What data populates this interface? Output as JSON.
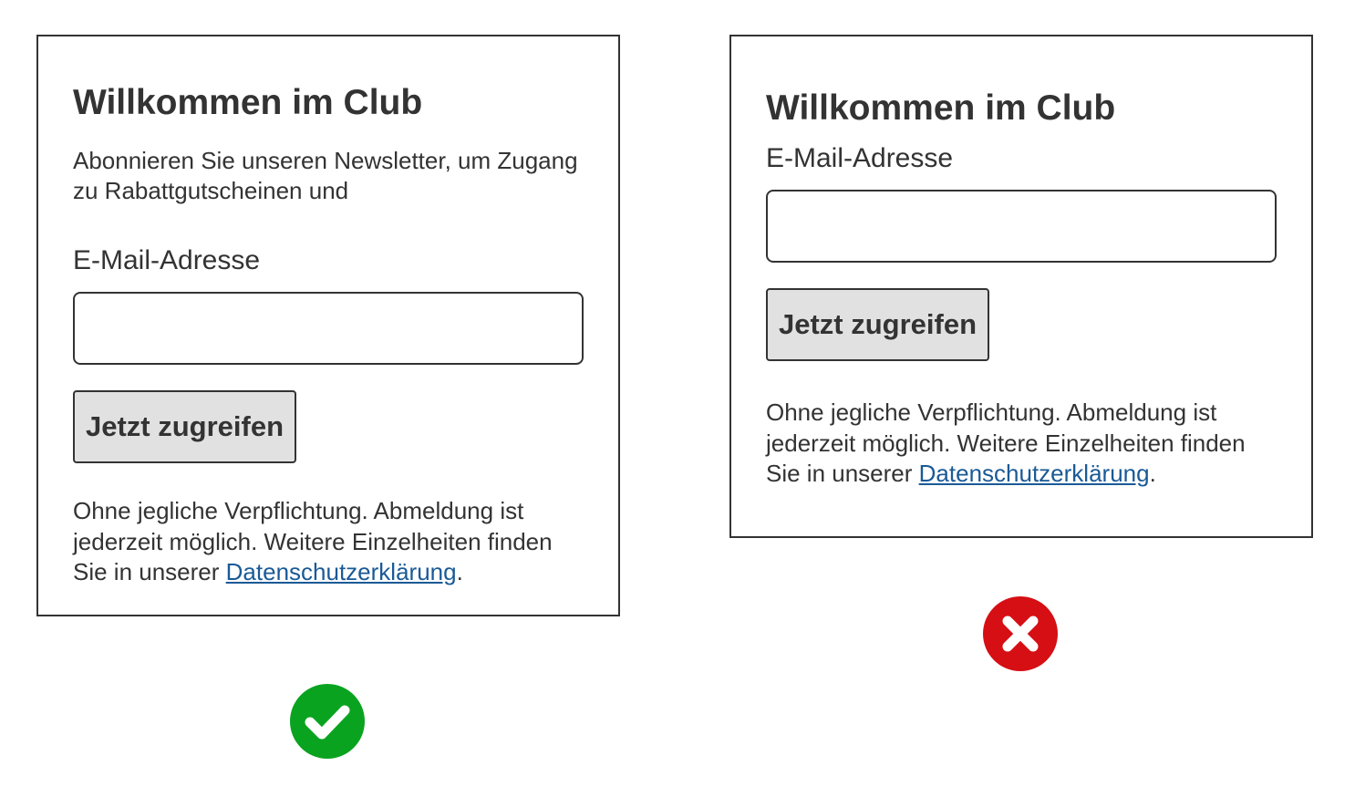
{
  "good_example": {
    "title": "Willkommen im Club",
    "intro": "Abonnieren Sie unseren Newsletter, um Zugang zu Rabattgutscheinen und",
    "email_label": "E-Mail-Adresse",
    "email_value": "",
    "button_label": "Jetzt zugreifen",
    "note_text": "Ohne jegliche Verpflichtung. Abmeldung ist jederzeit möglich. Weitere Einzelheiten finden Sie in unserer ",
    "privacy_link": "Datenschutzerklärung",
    "note_end": ".",
    "verdict_icon": "checkmark-icon",
    "verdict_color": "#0aa31f"
  },
  "bad_example": {
    "title": "Willkommen im Club",
    "email_label": "E-Mail-Adresse",
    "email_value": "",
    "button_label": "Jetzt zugreifen",
    "note_text": "Ohne jegliche Verpflichtung. Abmeldung ist jederzeit möglich. Weitere Einzelheiten finden Sie in unserer ",
    "privacy_link": "Datenschutzerklärung",
    "note_end": ".",
    "verdict_icon": "cross-icon",
    "verdict_color": "#d50f14"
  },
  "colors": {
    "text": "#333333",
    "border": "#333333",
    "button_bg": "#e1e1e1",
    "link": "#1a5a96"
  }
}
